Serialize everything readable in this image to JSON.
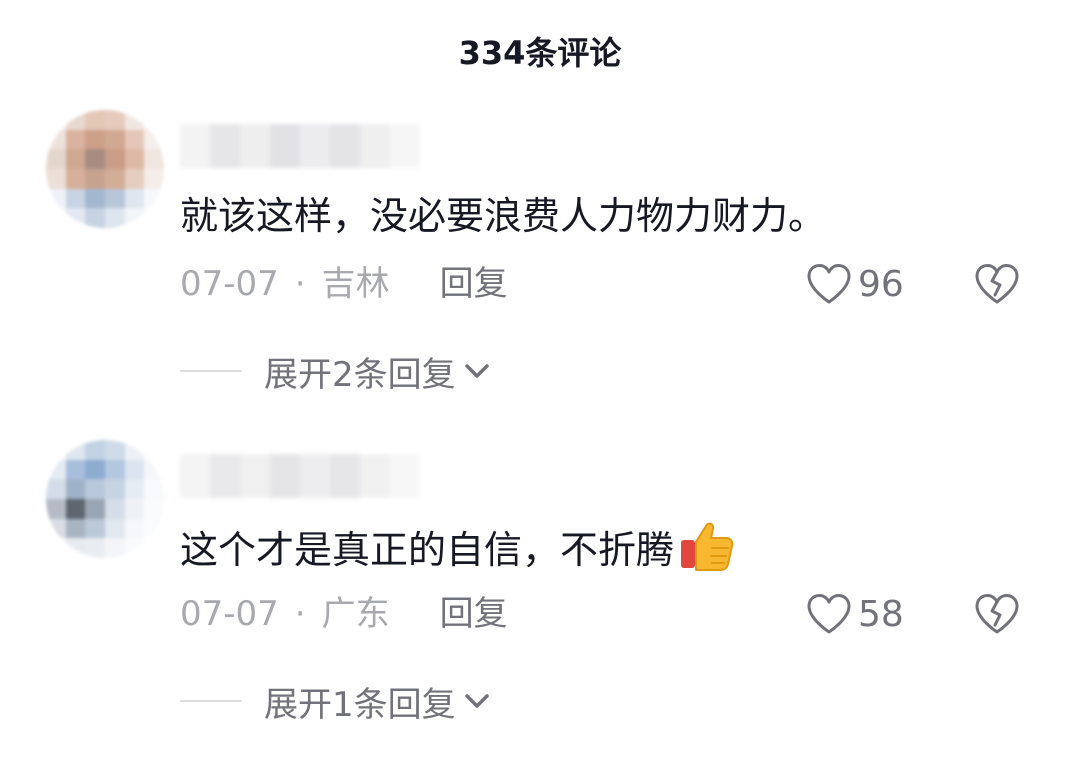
{
  "header": {
    "title": "334条评论"
  },
  "comments": [
    {
      "text": "就该这样，没必要浪费人力物力财力。",
      "date": "07-07",
      "location": "吉林",
      "reply_label": "回复",
      "likes": "96",
      "expand_label": "展开2条回复"
    },
    {
      "text": "这个才是真正的自信，不折腾",
      "emoji": "thumbs-up-icon",
      "date": "07-07",
      "location": "广东",
      "reply_label": "回复",
      "likes": "58",
      "expand_label": "展开1条回复"
    }
  ],
  "meta": {
    "separator": "·"
  },
  "colors": {
    "text": "#161823",
    "meta": "#a8a9ae",
    "action": "#72737a"
  }
}
